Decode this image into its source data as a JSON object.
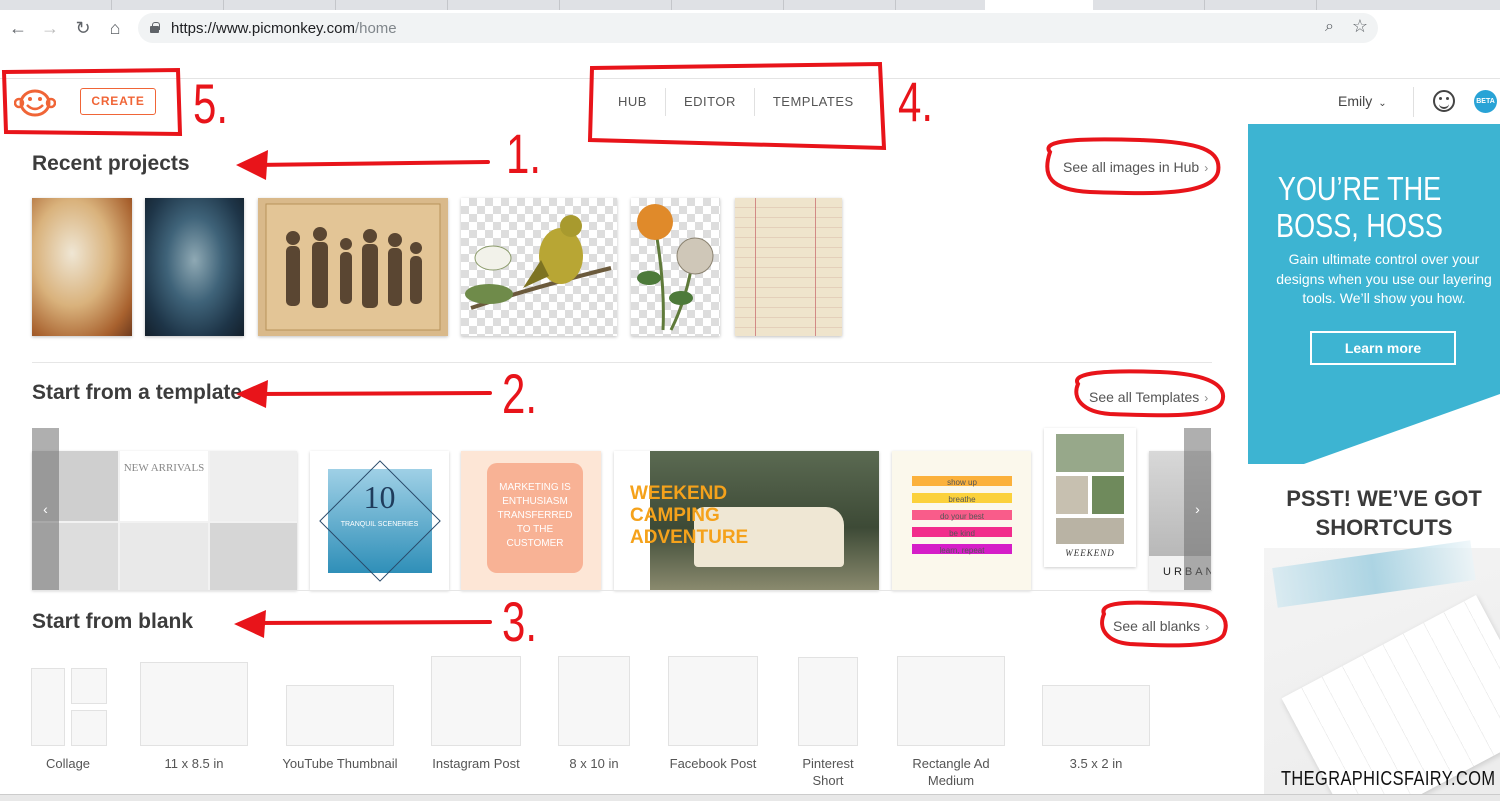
{
  "browser": {
    "url_host": "https://www.picmonkey.com",
    "url_path": "/home",
    "icons": [
      "back-icon",
      "forward-icon",
      "reload-icon",
      "home-icon",
      "lock-icon",
      "zoom-icon",
      "star-icon"
    ]
  },
  "header": {
    "create_label": "CREATE",
    "nav": [
      "HUB",
      "EDITOR",
      "TEMPLATES"
    ],
    "user_name": "Emily",
    "beta_label": "BETA"
  },
  "sections": {
    "recent": {
      "title": "Recent projects",
      "see_all": "See all images in Hub"
    },
    "template": {
      "title": "Start from a template",
      "see_all": "See all Templates"
    },
    "blank": {
      "title": "Start from blank",
      "see_all": "See all blanks"
    }
  },
  "templates": {
    "new_arrivals": "NEW ARRIVALS",
    "tranquil_number": "10",
    "tranquil_text": "TRANQUIL SCENERIES",
    "marketing": "MARKETING IS ENTHUSIASM TRANSFERRED TO THE CUSTOMER",
    "weekend": "WEEKEND CAMPING ADVENTURE",
    "show_up": [
      "show up",
      "breathe",
      "do your best",
      "be kind",
      "learn, repeat"
    ],
    "weekend_small": "WEEKEND",
    "urban": "URBAN"
  },
  "blanks": [
    "Collage",
    "11 x 8.5 in",
    "YouTube Thumbnail",
    "Instagram Post",
    "8 x 10 in",
    "Facebook Post",
    "Pinterest Short",
    "Rectangle Ad Medium",
    "3.5 x 2 in"
  ],
  "ad": {
    "headline": "YOU’RE THE BOSS, HOSS",
    "body": "Gain ultimate control over your designs when you use our layering tools. We’ll show you how.",
    "button": "Learn more",
    "headline2": "PSST! WE’VE GOT SHORTCUTS"
  },
  "annotations": {
    "numbers": [
      "1.",
      "2.",
      "3.",
      "4.",
      "5."
    ],
    "watermark": "THEGRAPHICSFAIRY.COM",
    "color": "#e8141a"
  },
  "colors": {
    "brand_orange": "#f06537",
    "ad_blue": "#3db4d2"
  }
}
